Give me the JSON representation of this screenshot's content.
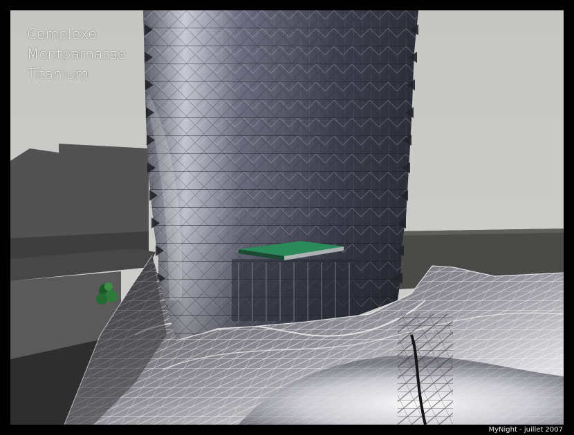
{
  "title_lines": [
    "Complexe",
    "Montparnasse",
    "Titanium"
  ],
  "credit": "MyNight - juillet 2007",
  "colors": {
    "frame": "#000000",
    "sky": "#c8c8c4",
    "tower": "#4a4c5c",
    "ground_buildings": "#4a4a48",
    "canopy_glass": "#2a8a5a",
    "roof_surface": "#d6d6da"
  }
}
